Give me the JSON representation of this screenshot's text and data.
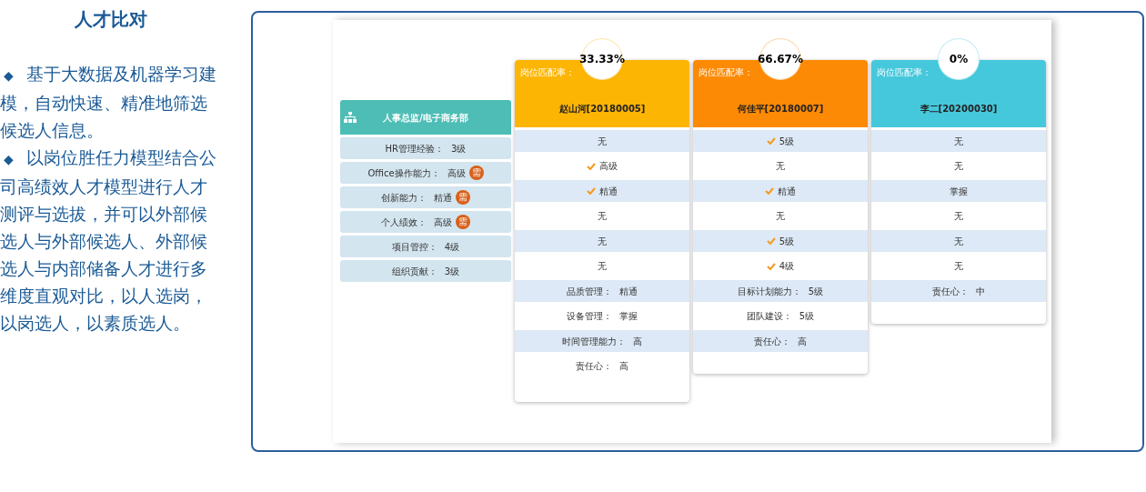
{
  "title": "人才比对",
  "bullets": [
    {
      "marker": "◆",
      "text": "基于大数据及机器学习建模，自动快速、精准地筛选候选人信息。"
    },
    {
      "marker": "◆",
      "text": "以岗位胜任力模型结合公司高绩效人才模型进行人才测评与选拔，并可以外部候选人与外部候选人、外部候选人与内部储备人才进行多维度直观对比，以人选岗，以岗选人，以素质选人。"
    }
  ],
  "position": {
    "title": "人事总监/电子商务部",
    "criteria": [
      {
        "label": "HR管理经验：",
        "value": "3级"
      },
      {
        "label": "Office操作能力：",
        "value": "高级",
        "badge": "需"
      },
      {
        "label": "创新能力：",
        "value": "精通",
        "badge": "需"
      },
      {
        "label": "个人绩效：",
        "value": "高级",
        "badge": "需"
      },
      {
        "label": "项目管控：",
        "value": "4级"
      },
      {
        "label": "组织贡献：",
        "value": "3级"
      }
    ]
  },
  "candidates": [
    {
      "rate": "33.33%",
      "rate_label": "岗位匹配率：",
      "name": "赵山河[20180005]",
      "color": "#fdb504",
      "rows": [
        {
          "kind": "criterion",
          "value": "无",
          "matched": false
        },
        {
          "kind": "criterion",
          "value": "高级",
          "matched": true
        },
        {
          "kind": "criterion",
          "value": "精通",
          "matched": true
        },
        {
          "kind": "criterion",
          "value": "无",
          "matched": false
        },
        {
          "kind": "criterion",
          "value": "无",
          "matched": false
        },
        {
          "kind": "criterion",
          "value": "无",
          "matched": false
        },
        {
          "kind": "extra",
          "label": "品质管理：",
          "value": "精通"
        },
        {
          "kind": "extra",
          "label": "设备管理：",
          "value": "掌握"
        },
        {
          "kind": "extra",
          "label": "时间管理能力：",
          "value": "高"
        },
        {
          "kind": "extra",
          "label": "责任心：",
          "value": "高"
        }
      ]
    },
    {
      "rate": "66.67%",
      "rate_label": "岗位匹配率：",
      "name": "何佳平[20180007]",
      "color": "#fd8a04",
      "rows": [
        {
          "kind": "criterion",
          "value": "5级",
          "matched": true
        },
        {
          "kind": "criterion",
          "value": "无",
          "matched": false
        },
        {
          "kind": "criterion",
          "value": "精通",
          "matched": true
        },
        {
          "kind": "criterion",
          "value": "无",
          "matched": false
        },
        {
          "kind": "criterion",
          "value": "5级",
          "matched": true
        },
        {
          "kind": "criterion",
          "value": "4级",
          "matched": true
        },
        {
          "kind": "extra",
          "label": "目标计划能力：",
          "value": "5级"
        },
        {
          "kind": "extra",
          "label": "团队建设：",
          "value": "5级"
        },
        {
          "kind": "extra",
          "label": "责任心：",
          "value": "高"
        }
      ]
    },
    {
      "rate": "0%",
      "rate_label": "岗位匹配率：",
      "name": "李二[20200030]",
      "color": "#46c8dc",
      "rows": [
        {
          "kind": "criterion",
          "value": "无",
          "matched": false
        },
        {
          "kind": "criterion",
          "value": "无",
          "matched": false
        },
        {
          "kind": "criterion",
          "value": "掌握",
          "matched": false
        },
        {
          "kind": "criterion",
          "value": "无",
          "matched": false
        },
        {
          "kind": "criterion",
          "value": "无",
          "matched": false
        },
        {
          "kind": "criterion",
          "value": "无",
          "matched": false
        },
        {
          "kind": "extra",
          "label": "责任心：",
          "value": "中"
        }
      ]
    }
  ]
}
